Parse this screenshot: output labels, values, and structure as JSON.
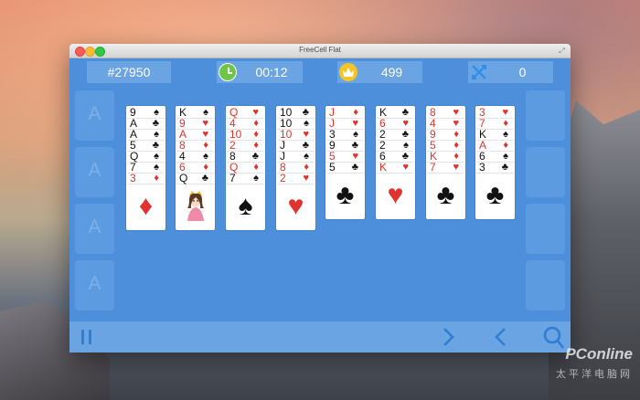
{
  "window": {
    "title": "FreeCell Flat"
  },
  "hud": {
    "game_number": "#27950",
    "time": "00:12",
    "score": "499",
    "moves": "0"
  },
  "free_cells": [
    "A",
    "A",
    "A",
    "A"
  ],
  "tableau": [
    {
      "cards": [
        {
          "rank": "9",
          "suit": "♠",
          "color": "black"
        },
        {
          "rank": "A",
          "suit": "♣",
          "color": "black"
        },
        {
          "rank": "A",
          "suit": "♠",
          "color": "black"
        },
        {
          "rank": "5",
          "suit": "♣",
          "color": "black"
        },
        {
          "rank": "Q",
          "suit": "♠",
          "color": "black"
        },
        {
          "rank": "7",
          "suit": "♠",
          "color": "black"
        },
        {
          "rank": "3",
          "suit": "♦",
          "color": "red"
        }
      ],
      "face": "♦",
      "face_color": "red"
    },
    {
      "cards": [
        {
          "rank": "K",
          "suit": "♠",
          "color": "black"
        },
        {
          "rank": "9",
          "suit": "♥",
          "color": "red"
        },
        {
          "rank": "A",
          "suit": "♥",
          "color": "red"
        },
        {
          "rank": "8",
          "suit": "♦",
          "color": "red"
        },
        {
          "rank": "4",
          "suit": "♠",
          "color": "black"
        },
        {
          "rank": "6",
          "suit": "♦",
          "color": "red"
        },
        {
          "rank": "Q",
          "suit": "♣",
          "color": "black"
        }
      ],
      "face": "princess",
      "face_color": "red"
    },
    {
      "cards": [
        {
          "rank": "Q",
          "suit": "♥",
          "color": "red"
        },
        {
          "rank": "4",
          "suit": "♦",
          "color": "red"
        },
        {
          "rank": "10",
          "suit": "♦",
          "color": "red"
        },
        {
          "rank": "2",
          "suit": "♦",
          "color": "red"
        },
        {
          "rank": "8",
          "suit": "♣",
          "color": "black"
        },
        {
          "rank": "Q",
          "suit": "♦",
          "color": "red"
        },
        {
          "rank": "7",
          "suit": "♠",
          "color": "black"
        }
      ],
      "face": "♠",
      "face_color": "black"
    },
    {
      "cards": [
        {
          "rank": "10",
          "suit": "♣",
          "color": "black"
        },
        {
          "rank": "10",
          "suit": "♠",
          "color": "black"
        },
        {
          "rank": "10",
          "suit": "♥",
          "color": "red"
        },
        {
          "rank": "J",
          "suit": "♣",
          "color": "black"
        },
        {
          "rank": "J",
          "suit": "♠",
          "color": "black"
        },
        {
          "rank": "8",
          "suit": "♦",
          "color": "red"
        },
        {
          "rank": "2",
          "suit": "♥",
          "color": "red"
        }
      ],
      "face": "♥",
      "face_color": "red"
    },
    {
      "cards": [
        {
          "rank": "J",
          "suit": "♦",
          "color": "red"
        },
        {
          "rank": "J",
          "suit": "♥",
          "color": "red"
        },
        {
          "rank": "3",
          "suit": "♠",
          "color": "black"
        },
        {
          "rank": "9",
          "suit": "♣",
          "color": "black"
        },
        {
          "rank": "5",
          "suit": "♥",
          "color": "red"
        },
        {
          "rank": "5",
          "suit": "♣",
          "color": "black"
        }
      ],
      "face": "♣",
      "face_color": "black"
    },
    {
      "cards": [
        {
          "rank": "K",
          "suit": "♣",
          "color": "black"
        },
        {
          "rank": "6",
          "suit": "♥",
          "color": "red"
        },
        {
          "rank": "2",
          "suit": "♣",
          "color": "black"
        },
        {
          "rank": "2",
          "suit": "♠",
          "color": "black"
        },
        {
          "rank": "6",
          "suit": "♣",
          "color": "black"
        },
        {
          "rank": "K",
          "suit": "♥",
          "color": "red"
        }
      ],
      "face": "♥",
      "face_color": "red"
    },
    {
      "cards": [
        {
          "rank": "8",
          "suit": "♥",
          "color": "red"
        },
        {
          "rank": "4",
          "suit": "♥",
          "color": "red"
        },
        {
          "rank": "9",
          "suit": "♦",
          "color": "red"
        },
        {
          "rank": "5",
          "suit": "♦",
          "color": "red"
        },
        {
          "rank": "K",
          "suit": "♦",
          "color": "red"
        },
        {
          "rank": "7",
          "suit": "♥",
          "color": "red"
        }
      ],
      "face": "♣",
      "face_color": "black"
    },
    {
      "cards": [
        {
          "rank": "3",
          "suit": "♥",
          "color": "red"
        },
        {
          "rank": "7",
          "suit": "♦",
          "color": "red"
        },
        {
          "rank": "K",
          "suit": "♠",
          "color": "black"
        },
        {
          "rank": "A",
          "suit": "♦",
          "color": "red"
        },
        {
          "rank": "6",
          "suit": "♠",
          "color": "black"
        },
        {
          "rank": "3",
          "suit": "♣",
          "color": "black"
        }
      ],
      "face": "♣",
      "face_color": "black"
    }
  ],
  "foundations": [
    "",
    "",
    "",
    ""
  ],
  "watermark": {
    "brand": "PConline",
    "sub": "太平洋电脑网"
  },
  "colors": {
    "table": "#4d8fdb",
    "hud": "#6aa4e3",
    "card_red": "#e0332d",
    "card_black": "#111111",
    "button": "#2f7dd6"
  }
}
